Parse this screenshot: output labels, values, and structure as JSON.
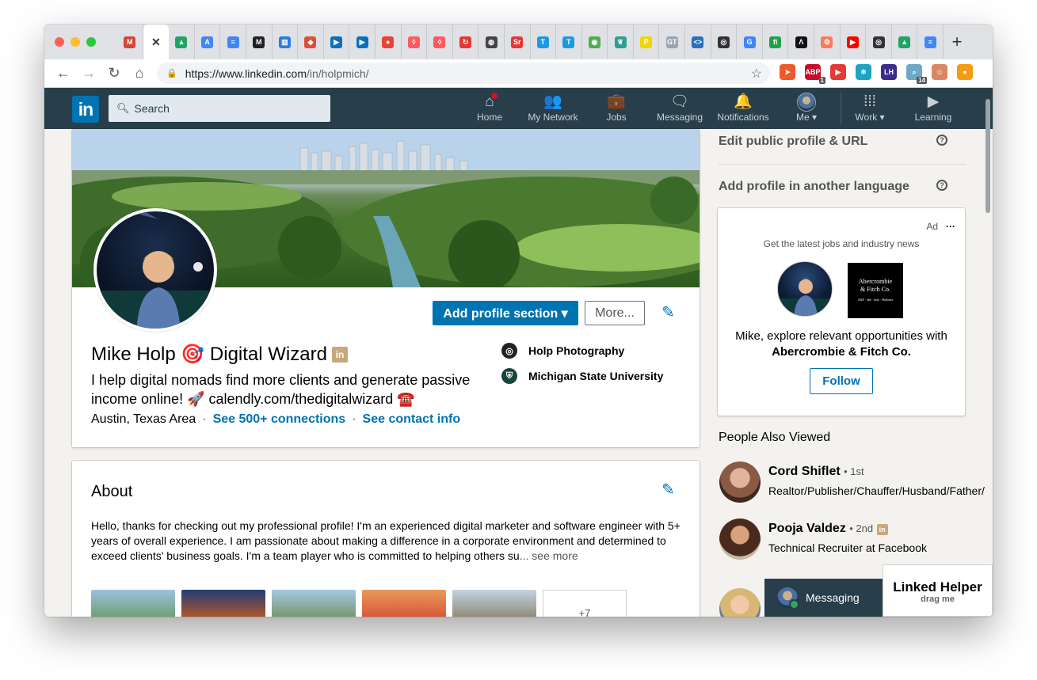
{
  "browser": {
    "tabs": [
      {
        "icon": "gmail-icon",
        "glyph": "M",
        "color": "#d44638"
      },
      {
        "icon": "close-icon",
        "glyph": "✕",
        "color": "#333333",
        "active": true
      },
      {
        "icon": "drive-icon",
        "glyph": "▲",
        "color": "#1fa463"
      },
      {
        "icon": "google-ads-icon",
        "glyph": "A",
        "color": "#4285f4"
      },
      {
        "icon": "docs-icon",
        "glyph": "≡",
        "color": "#4285f4"
      },
      {
        "icon": "medium-icon",
        "glyph": "M",
        "color": "#222222"
      },
      {
        "icon": "analytics-icon",
        "glyph": "▥",
        "color": "#2c7be5"
      },
      {
        "icon": "figma-icon",
        "glyph": "◆",
        "color": "#e04e39"
      },
      {
        "icon": "screencast-icon",
        "glyph": "▶",
        "color": "#0a6fbf"
      },
      {
        "icon": "screencast-icon",
        "glyph": "▶",
        "color": "#0a6fbf"
      },
      {
        "icon": "maps-pin-icon",
        "glyph": "●",
        "color": "#ea4335"
      },
      {
        "icon": "airbnb-icon",
        "glyph": "◊",
        "color": "#ff5a5f"
      },
      {
        "icon": "airbnb-icon",
        "glyph": "◊",
        "color": "#ff5a5f"
      },
      {
        "icon": "reload-icon",
        "glyph": "↻",
        "color": "#e53935"
      },
      {
        "icon": "globe-icon",
        "glyph": "◍",
        "color": "#444444"
      },
      {
        "icon": "sr-icon",
        "glyph": "Sr",
        "color": "#e53935"
      },
      {
        "icon": "t-icon",
        "glyph": "T",
        "color": "#1a9ae0"
      },
      {
        "icon": "t-icon",
        "glyph": "T",
        "color": "#1a9ae0"
      },
      {
        "icon": "chrome-icon",
        "glyph": "◉",
        "color": "#4caf50"
      },
      {
        "icon": "leaf-icon",
        "glyph": "❦",
        "color": "#2e9e8e"
      },
      {
        "icon": "p-icon",
        "glyph": "P",
        "color": "#f2d500"
      },
      {
        "icon": "gt-icon",
        "glyph": "GT",
        "color": "#9aa4b5"
      },
      {
        "icon": "code-icon",
        "glyph": "<>",
        "color": "#2c6fbd"
      },
      {
        "icon": "camera-icon",
        "glyph": "◎",
        "color": "#333333"
      },
      {
        "icon": "google-icon",
        "glyph": "G",
        "color": "#4285f4"
      },
      {
        "icon": "fi-icon",
        "glyph": "fi",
        "color": "#24a148"
      },
      {
        "icon": "a-icon",
        "glyph": "Λ",
        "color": "#111111"
      },
      {
        "icon": "hubspot-icon",
        "glyph": "⚙",
        "color": "#ff7a59"
      },
      {
        "icon": "youtube-icon",
        "glyph": "▶",
        "color": "#ff0000"
      },
      {
        "icon": "camera-icon",
        "glyph": "◎",
        "color": "#333333"
      },
      {
        "icon": "drive-icon",
        "glyph": "▲",
        "color": "#1fa463"
      },
      {
        "icon": "docs-icon",
        "glyph": "≡",
        "color": "#4285f4"
      }
    ],
    "new_tab": "+",
    "back": "←",
    "forward": "→",
    "reload": "↻",
    "home": "⌂",
    "url_host": "https://www.linkedin.com",
    "url_path": "/in/holpmich/",
    "extensions": [
      {
        "icon": "rocket-ext-icon",
        "glyph": "➤",
        "color": "#f0592a",
        "badge": ""
      },
      {
        "icon": "adblock-ext-icon",
        "glyph": "ABP",
        "color": "#c70d2c",
        "badge": "1"
      },
      {
        "icon": "forward-ext-icon",
        "glyph": "▶",
        "color": "#e53935",
        "badge": ""
      },
      {
        "icon": "react-ext-icon",
        "glyph": "⚛",
        "color": "#1fa3c4",
        "badge": ""
      },
      {
        "icon": "lighthouse-ext-icon",
        "glyph": "LH",
        "color": "#3b2c8e",
        "badge": ""
      },
      {
        "icon": "search-ext-icon",
        "glyph": "⌕",
        "color": "#6fa7c6",
        "badge": "14"
      },
      {
        "icon": "profile-ext-icon",
        "glyph": "☺",
        "color": "#d98863",
        "badge": ""
      },
      {
        "icon": "orange-ext-icon",
        "glyph": "●",
        "color": "#f39c12",
        "badge": ""
      }
    ]
  },
  "linkedin": {
    "logo": "in",
    "search_placeholder": "Search",
    "nav": [
      {
        "label": "Home",
        "icon": "home-icon",
        "glyph": "⌂"
      },
      {
        "label": "My Network",
        "icon": "network-icon",
        "glyph": "👥"
      },
      {
        "label": "Jobs",
        "icon": "briefcase-icon",
        "glyph": "💼"
      },
      {
        "label": "Messaging",
        "icon": "messaging-icon",
        "glyph": "🗨"
      },
      {
        "label": "Notifications",
        "icon": "bell-icon",
        "glyph": "🔔"
      },
      {
        "label": "Me ▾",
        "icon": "me-avatar",
        "glyph": ""
      },
      {
        "label": "Work ▾",
        "icon": "grid-icon",
        "glyph": "⁞⁞⁞"
      },
      {
        "label": "Learning",
        "icon": "learning-icon",
        "glyph": "▶"
      }
    ],
    "profile": {
      "add_section_label": "Add profile section ▾",
      "more_label": "More...",
      "name": "Mike Holp 🎯 Digital Wizard",
      "premium_badge": "in",
      "headline": "I help digital nomads find more clients and generate passive income online! 🚀 calendly.com/thedigitalwizard ☎️",
      "location": "Austin, Texas Area",
      "connections": "See 500+ connections",
      "contact": "See contact info",
      "sep": "·",
      "companies": [
        {
          "name": "Holp Photography",
          "color": "#222222",
          "glyph": "◎"
        },
        {
          "name": "Michigan State University",
          "color": "#18453b",
          "glyph": "⛨"
        }
      ]
    },
    "about": {
      "title": "About",
      "text": "Hello, thanks for checking out my professional profile! I'm an experienced digital marketer and software engineer with 5+ years of overall experience. I am passionate about making a difference in a corporate environment and determined to exceed clients' business goals. I'm a team player who is committed to helping others su",
      "see_more": "... see more",
      "media_more": "+7"
    },
    "rail": {
      "edit_url": "Edit public profile & URL",
      "add_language": "Add profile in another language",
      "help_glyph": "?",
      "ad": {
        "label": "Ad",
        "menu": "···",
        "subtitle": "Get the latest jobs and industry news",
        "brand_line1": "Abercrombie",
        "brand_line2": "& Fitch Co.",
        "brand_small": "A&F · abe · kids · Hollister",
        "text_prefix": "Mike, explore relevant opportunities with",
        "text_company": "Abercrombie & Fitch Co.",
        "follow": "Follow"
      },
      "people_also_viewed": "People Also Viewed",
      "people": [
        {
          "name": "Cord Shiflet",
          "degree": "• 1st",
          "title": "Realtor/Publisher/Chauffer/Husband/Father/",
          "badge": false
        },
        {
          "name": "Pooja Valdez",
          "degree": "• 2nd",
          "title": "Technical Recruiter at Facebook",
          "badge": true
        }
      ]
    },
    "messaging_label": "Messaging",
    "helper_title": "Linked Helper",
    "helper_sub": "drag me"
  }
}
